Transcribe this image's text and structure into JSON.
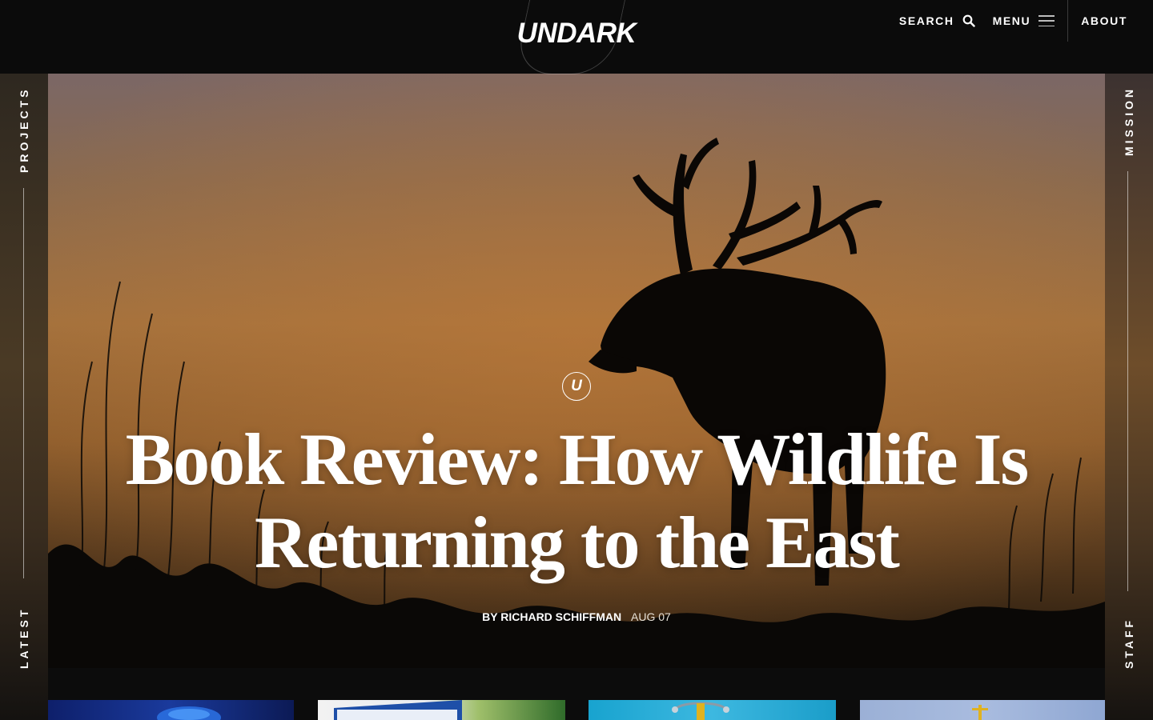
{
  "header": {
    "logo": "UNDARK",
    "nav": {
      "search_label": "SEARCH",
      "menu_label": "MENU",
      "about_label": "ABOUT"
    }
  },
  "rails": {
    "left_top": "PROJECTS",
    "left_bottom": "LATEST",
    "right_top": "MISSION",
    "right_bottom": "STAFF"
  },
  "hero": {
    "badge": "U",
    "title": "Book Review: How Wildlife Is Returning to the East",
    "author": "BY RICHARD SCHIFFMAN",
    "date": "AUG 07"
  },
  "thumbnails": [
    {
      "subject": "blue-sphere"
    },
    {
      "subject": "sign-and-trees"
    },
    {
      "subject": "stethoscope"
    },
    {
      "subject": "sky-with-crane"
    }
  ],
  "colors": {
    "header_bg": "#0b0b0b",
    "text": "#ffffff",
    "hero_sky": "#a3713d"
  }
}
